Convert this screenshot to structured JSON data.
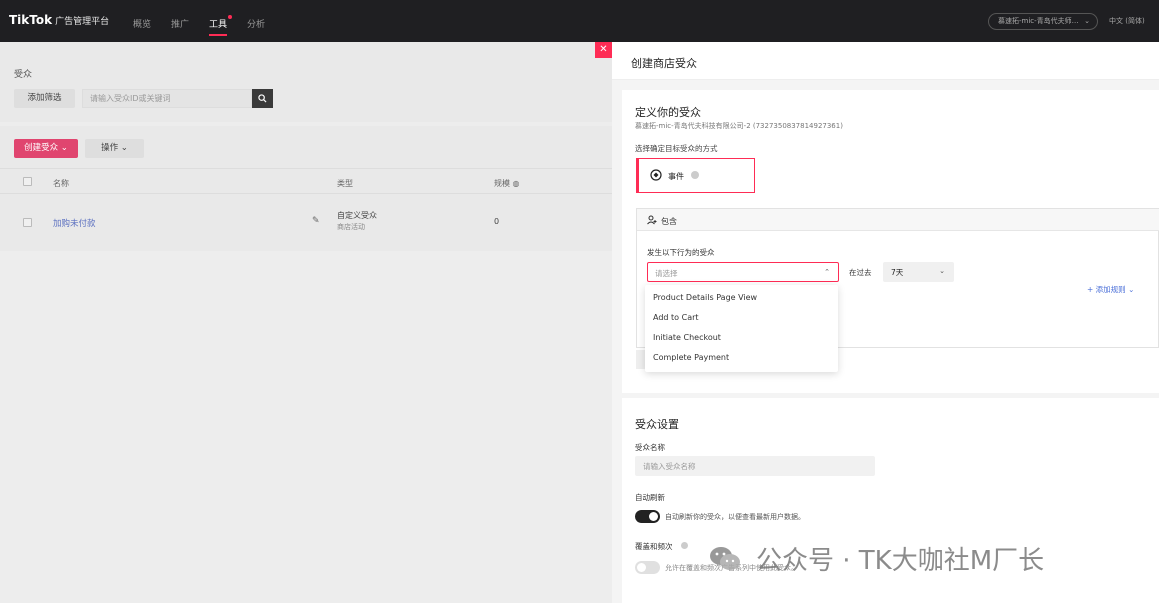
{
  "topbar": {
    "logo": "TikTok",
    "logo_sub": "广告管理平台",
    "nav": [
      "概览",
      "推广",
      "工具",
      "分析"
    ],
    "active_nav": "工具",
    "account": "慕速拓-mic-青岛代夫师…",
    "lang": "中文 (简体)"
  },
  "left": {
    "breadcrumb": "受众",
    "add_filter": "添加筛选",
    "search_placeholder": "请输入受众ID或关键词",
    "create_btn": "创建受众",
    "ops_btn": "操作",
    "columns": {
      "name": "名称",
      "type": "类型",
      "size": "规模"
    },
    "row": {
      "name": "加购未付款",
      "type": "自定义受众",
      "subtype": "商店活动",
      "size": "0"
    }
  },
  "drawer": {
    "title": "创建商店受众",
    "define_title": "定义你的受众",
    "define_sub": "慕速拓-mic-青岛代夫科技有限公司-2 (7327350837814927361)",
    "method_label": "选择确定目标受众的方式",
    "event_label": "事件",
    "include_label": "包含",
    "cond_label": "发生以下行为的受众",
    "select_placeholder": "请选择",
    "in_past": "在过去",
    "days": "7天",
    "add_rule": "+ 添加规则",
    "menu": [
      "Product Details Page View",
      "Add to Cart",
      "Initiate Checkout",
      "Complete Payment"
    ],
    "settings_title": "受众设置",
    "name_label": "受众名称",
    "name_placeholder": "请输入受众名称",
    "auto_refresh_label": "自动刷新",
    "auto_refresh_text": "自动刷新你的受众，以便查看最新用户数据。",
    "coverage_label": "覆盖和频次",
    "coverage_text": "允许在覆盖和频次广告系列中使用此受众。"
  },
  "watermark": {
    "text": "公众号 · TK大咖社M厂长"
  },
  "colors": {
    "accent": "#fe2c55",
    "link": "#4a6fd8"
  }
}
